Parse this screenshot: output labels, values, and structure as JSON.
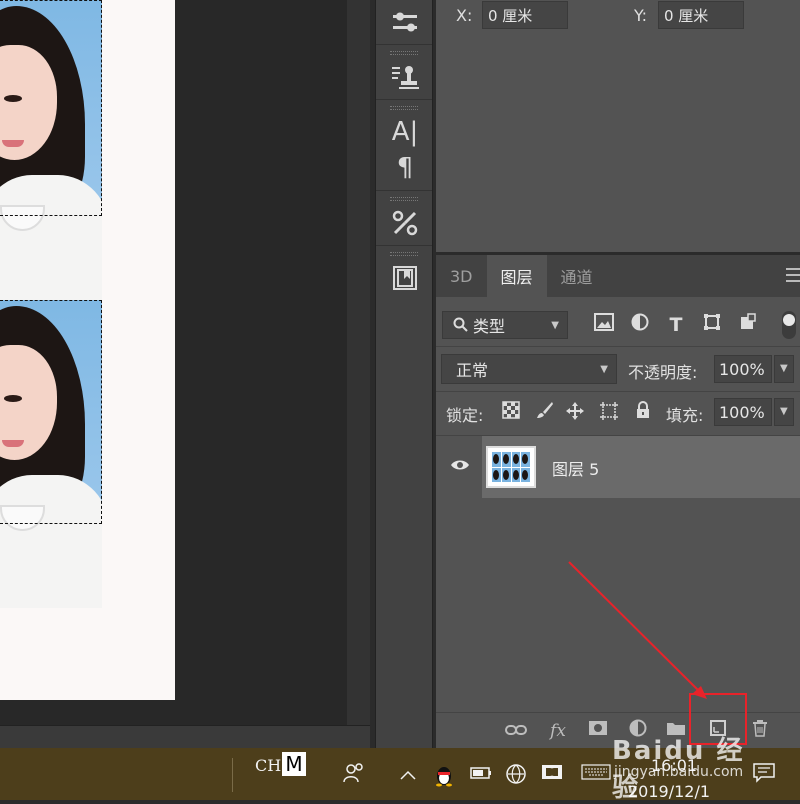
{
  "properties": {
    "x_label": "X:",
    "x_value": "0 厘米",
    "y_label": "Y:",
    "y_value": "0 厘米"
  },
  "tools": [
    {
      "name": "adjust-icon"
    },
    {
      "name": "stamp-icon"
    },
    {
      "name": "character-icon",
      "glyph": "A|"
    },
    {
      "name": "paragraph-icon",
      "glyph": "¶"
    },
    {
      "name": "tools-icon"
    },
    {
      "name": "book-icon"
    }
  ],
  "layers_panel": {
    "tabs": [
      {
        "label": "3D",
        "active": false
      },
      {
        "label": "图层",
        "active": true
      },
      {
        "label": "通道",
        "active": false
      }
    ],
    "filter_kind": "类型",
    "blend_mode": "正常",
    "opacity_label": "不透明度:",
    "opacity_value": "100%",
    "lock_label": "锁定:",
    "fill_label": "填充:",
    "fill_value": "100%",
    "layers": [
      {
        "name": "图层 5",
        "visible": true,
        "selected": true
      }
    ]
  },
  "taskbar": {
    "ime": "CH",
    "ime_mode": "M",
    "time": "16:01",
    "date": "2019/12/1"
  },
  "watermark": {
    "text": "Baidu 经验",
    "url": "jingyan.baidu.com"
  },
  "colors": {
    "annotation_red": "#e8232a",
    "panel_bg": "#535353",
    "taskbar_bg": "#4d3e1b"
  }
}
